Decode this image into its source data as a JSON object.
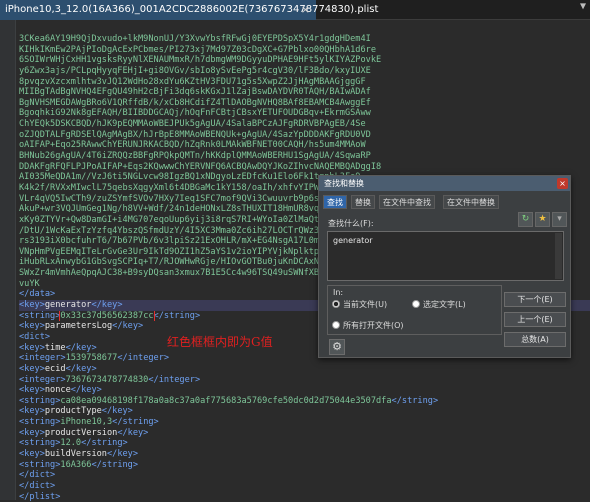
{
  "tab": {
    "title": "iPhone10,3_12.0(16A366)_001A2CDC2886002E(7367673478774830).plist",
    "close_glyph": "×",
    "dropdown_glyph": "▼"
  },
  "editor": {
    "lines": [
      {
        "kind": "b64",
        "text": "3CKea6AY19H9QjDxvudo+lkM9NonUJ/Y3XvwYbsfRFwGj0EYEPDSpX5Y4r1gdgHDem4I"
      },
      {
        "kind": "b64",
        "text": "KIHkIKmEw2PAjPIoDgAcExPCbmes/PI273xj7Md97Z03cDgXC+G7Pblxo00QHbhA1d6re"
      },
      {
        "kind": "b64",
        "text": "6SOIWrWHjCxHH1vgsksRyyNlXENAUMmxR/h7dbmgWM9DGyyuDPHAE9HFt5ylKIYAZPovkE"
      },
      {
        "kind": "b64",
        "text": "y6Zwx3ajs/PCLpqHyyqFEHjI+gi8OVGv/sbIo8ySvEePg5r4cgV30/lF3Bdo/kxyIUXE"
      },
      {
        "kind": "b64",
        "text": "8pvqzvXzcxmlhtw3vJQ12WdHo28xdYu6KZtHV3FDU71g5s5XwpZ2JjHAgMBAAGjggGF"
      },
      {
        "kind": "b64",
        "text": "MIIBgTAdBgNVHQ4EFgQU49hH2cBjFi3dq6skKGxJ1lZajBswDAYDVR0TAQH/BAIwADAf"
      },
      {
        "kind": "b64",
        "text": "BgNVHSMEGDAWgBRo6V1QRffdB/k/xCb8HCdifZ4TlDAOBgNVHQ8BAf8EBAMCB4AwggEf"
      },
      {
        "kind": "b64",
        "text": "BgoqhkiG92Nk8gEFAQH/BIIBDDGCAQj/hOqFnFCBtjCBsxYETUFOUDGBqv+EkrmGSAww"
      },
      {
        "kind": "b64",
        "text": "ChYEQk5DSKCBQD/hJK9pEQMMAoWBEJPUk5gAgUA/4SalaBPCzAJFgRDRVBPAgEB/4Se"
      },
      {
        "kind": "b64",
        "text": "oZJQDTALFgRDSElQAgMAgBX/hJrBpE8MMAoWBENQUk+gAgUA/4SazYpDDDAKFgRDU0VD"
      },
      {
        "kind": "b64",
        "text": "oAIFAP+Eqo25RAwwChYERUNJRKACBQD/hZqRnk0LMAkWBFNET00CAQH/hs5um4MMAoW"
      },
      {
        "kind": "b64",
        "text": "BHNub26gAgUA/4T6iZRQQzBBFgRPQkpQMTn/hKKdplQMMAoWBERHU1SgAgUA/4SqwaRP"
      },
      {
        "kind": "b64",
        "text": "DDAKFgRFQFLPJPoAIFAP+Eqs2KQwwwChYERVNFQ6ACBQAwDQYJKoZIhvcNAQEMBQADggI8"
      },
      {
        "kind": "b64",
        "text": "AI035MeQDA1m//VzJ6ti5NGLvcw98IgzBQ1xNDgyoLzEDfcKu1Elo6Fk1tgnbL3Fs9"
      },
      {
        "kind": "b64",
        "text": "K4k2f/RVXxMIwclL75qebsXqgyXml6t4DBGaMc1kY158/oaIh/xhfvYIPWUGm3zl+"
      },
      {
        "kind": "b64",
        "text": "VLr4qVQ5IwCTh9/zuZSYmfSVOv7HXy7Ieq1SFC7mof9QVi3Cwuuvrb9p6sYbS"
      },
      {
        "kind": "b64",
        "text": "AkuP+wr3VQJUmGeg1Ng/h8VV+Wdf/24n1deHONxLZ8sTHUXIT18HmUR8vqcPO"
      },
      {
        "kind": "b64",
        "text": "xKy0ZTYVr+Qw8DamGI+i4MG707eqoUup6yij3i8rqS7RI+WYoIa0ZlMaQt382"
      },
      {
        "kind": "b64",
        "text": "/DtU/1WcKaExTzYzfq4YbszQSfmdUzY/4I5XC3Mma0Zc6ih27LOCTrQWz3BkE"
      },
      {
        "kind": "b64",
        "text": "rs3193iX0bcfuhrT6/7b67PVb/6v3lpiSz21ExOHLR/mX+EG4NsgA17L0m2BJ"
      },
      {
        "kind": "b64",
        "text": "VNpHmPVgEEMqITeLrGvGe3Ur9IkTd9OZI1hZ5aYS1v2ioYIPYVjkNplktpzp"
      },
      {
        "kind": "b64",
        "text": "iHubRLxAnwybG1GbSvgSCPIq+T7/RJOWHwRGje/HIOvGOTBu0juKnDCAxN96"
      },
      {
        "kind": "b64",
        "text": "SWxZr4mVmhAeQpqAJC38+B9syDQsan3xmux7B1E5Cc4w96TSQ49uSWNfXBUBz"
      },
      {
        "kind": "b64",
        "text": "vuYK"
      },
      {
        "kind": "mixed",
        "parts": [
          {
            "c": "tag",
            "t": "</data>"
          }
        ]
      },
      {
        "kind": "mixed",
        "hl": true,
        "parts": [
          {
            "c": "tag",
            "t": "<key>"
          },
          {
            "c": "txt",
            "t": "generator"
          },
          {
            "c": "tag",
            "t": "</key>"
          }
        ]
      },
      {
        "kind": "mixed",
        "parts": [
          {
            "c": "tag",
            "t": "<string>"
          },
          {
            "c": "val",
            "t": "0x33c37d56562387cc",
            "box": true
          },
          {
            "c": "tag",
            "t": "</string>"
          }
        ]
      },
      {
        "kind": "mixed",
        "parts": [
          {
            "c": "tag",
            "t": "<key>"
          },
          {
            "c": "txt",
            "t": "parametersLog"
          },
          {
            "c": "tag",
            "t": "</key>"
          }
        ]
      },
      {
        "kind": "mixed",
        "parts": [
          {
            "c": "tag",
            "t": "<dict>"
          }
        ]
      },
      {
        "kind": "mixed",
        "parts": [
          {
            "c": "tag",
            "t": "  <key>"
          },
          {
            "c": "txt",
            "t": "time"
          },
          {
            "c": "tag",
            "t": "</key>"
          }
        ]
      },
      {
        "kind": "mixed",
        "parts": [
          {
            "c": "tag",
            "t": "  <integer>"
          },
          {
            "c": "val",
            "t": "1539758677"
          },
          {
            "c": "tag",
            "t": "</integer>"
          }
        ]
      },
      {
        "kind": "mixed",
        "parts": [
          {
            "c": "tag",
            "t": "  <key>"
          },
          {
            "c": "txt",
            "t": "ecid"
          },
          {
            "c": "tag",
            "t": "</key>"
          }
        ]
      },
      {
        "kind": "mixed",
        "parts": [
          {
            "c": "tag",
            "t": "  <integer>"
          },
          {
            "c": "val",
            "t": "7367673478774830"
          },
          {
            "c": "tag",
            "t": "</integer>"
          }
        ]
      },
      {
        "kind": "mixed",
        "parts": [
          {
            "c": "tag",
            "t": "  <key>"
          },
          {
            "c": "txt",
            "t": "nonce"
          },
          {
            "c": "tag",
            "t": "</key>"
          }
        ]
      },
      {
        "kind": "mixed",
        "parts": [
          {
            "c": "tag",
            "t": "  <string>"
          },
          {
            "c": "val",
            "t": "ca08ea09468198f178a0a8c37a0af775683a5769cfe50dc0d2d75044e3507dfa"
          },
          {
            "c": "tag",
            "t": "</string>"
          }
        ]
      },
      {
        "kind": "mixed",
        "parts": [
          {
            "c": "tag",
            "t": "  <key>"
          },
          {
            "c": "txt",
            "t": "productType"
          },
          {
            "c": "tag",
            "t": "</key>"
          }
        ]
      },
      {
        "kind": "mixed",
        "parts": [
          {
            "c": "tag",
            "t": "  <string>"
          },
          {
            "c": "val",
            "t": "iPhone10,3"
          },
          {
            "c": "tag",
            "t": "</string>"
          }
        ]
      },
      {
        "kind": "mixed",
        "parts": [
          {
            "c": "tag",
            "t": "  <key>"
          },
          {
            "c": "txt",
            "t": "productVersion"
          },
          {
            "c": "tag",
            "t": "</key>"
          }
        ]
      },
      {
        "kind": "mixed",
        "parts": [
          {
            "c": "tag",
            "t": "  <string>"
          },
          {
            "c": "val",
            "t": "12.0"
          },
          {
            "c": "tag",
            "t": "</string>"
          }
        ]
      },
      {
        "kind": "mixed",
        "parts": [
          {
            "c": "tag",
            "t": "  <key>"
          },
          {
            "c": "txt",
            "t": "buildVersion"
          },
          {
            "c": "tag",
            "t": "</key>"
          }
        ]
      },
      {
        "kind": "mixed",
        "parts": [
          {
            "c": "tag",
            "t": "  <string>"
          },
          {
            "c": "val",
            "t": "16A366"
          },
          {
            "c": "tag",
            "t": "</string>"
          }
        ]
      },
      {
        "kind": "mixed",
        "parts": [
          {
            "c": "tag",
            "t": "</dict>"
          }
        ]
      },
      {
        "kind": "mixed",
        "parts": [
          {
            "c": "tag",
            "t": "</dict>"
          }
        ]
      },
      {
        "kind": "mixed",
        "parts": [
          {
            "c": "tag",
            "t": "</plist>"
          }
        ]
      }
    ]
  },
  "annotation": "红色框框内即为G值",
  "find_dialog": {
    "title": "查找和替换",
    "close_glyph": "×",
    "tabs": [
      "查找",
      "替换",
      "在文件中查找",
      "在文件中替换"
    ],
    "active_tab": 0,
    "find_label": "查找什么(F):",
    "find_value": "generator",
    "scope_title": "In:",
    "scope_options": {
      "current_file": "当前文件(U)",
      "selection": "选定文字(L)",
      "all_open": "所有打开文件(O)"
    },
    "buttons": {
      "next": "下一个(E)",
      "prev": "上一个(E)",
      "count": "总数(A)"
    },
    "icons": {
      "history": "↻",
      "bookmark": "★",
      "option": "▾"
    },
    "gear_glyph": "⚙"
  },
  "colors": {
    "accent": "#2f65a8",
    "highlight_box": "#e03030",
    "annotation": "#e02020"
  }
}
